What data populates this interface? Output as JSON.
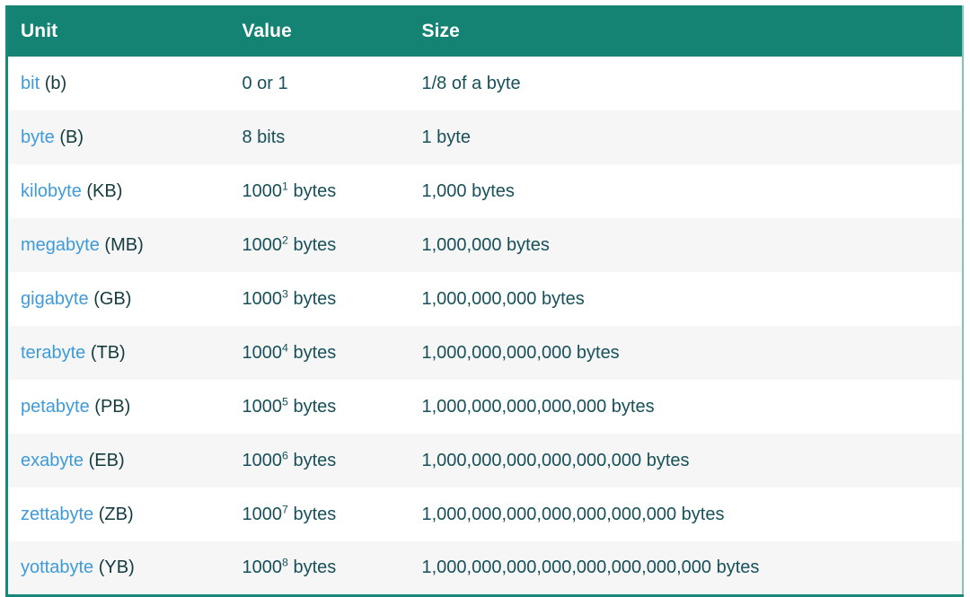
{
  "table": {
    "columns": [
      {
        "key": "unit",
        "label": "Unit"
      },
      {
        "key": "value",
        "label": "Value"
      },
      {
        "key": "size",
        "label": "Size"
      }
    ],
    "header_background": "#148373",
    "header_text_color": "#ffffff",
    "link_color": "#3f9ad8",
    "text_color": "#17505a",
    "border_color": "#17887a",
    "stripe_color": "#f5f6f5",
    "rows": [
      {
        "unit_name": "bit",
        "unit_abbr": "(b)",
        "value_base": "0 or 1",
        "value_exponent": "",
        "value_suffix": "",
        "size": "1/8 of a byte"
      },
      {
        "unit_name": "byte",
        "unit_abbr": "(B)",
        "value_base": "8 bits",
        "value_exponent": "",
        "value_suffix": "",
        "size": "1 byte"
      },
      {
        "unit_name": "kilobyte",
        "unit_abbr": "(KB)",
        "value_base": "1000",
        "value_exponent": "1",
        "value_suffix": " bytes",
        "size": "1,000 bytes"
      },
      {
        "unit_name": "megabyte",
        "unit_abbr": "(MB)",
        "value_base": "1000",
        "value_exponent": "2",
        "value_suffix": " bytes",
        "size": "1,000,000 bytes"
      },
      {
        "unit_name": "gigabyte",
        "unit_abbr": "(GB)",
        "value_base": "1000",
        "value_exponent": "3",
        "value_suffix": " bytes",
        "size": "1,000,000,000 bytes"
      },
      {
        "unit_name": "terabyte",
        "unit_abbr": "(TB)",
        "value_base": "1000",
        "value_exponent": "4",
        "value_suffix": " bytes",
        "size": "1,000,000,000,000 bytes"
      },
      {
        "unit_name": "petabyte",
        "unit_abbr": "(PB)",
        "value_base": "1000",
        "value_exponent": "5",
        "value_suffix": " bytes",
        "size": "1,000,000,000,000,000 bytes"
      },
      {
        "unit_name": "exabyte",
        "unit_abbr": "(EB)",
        "value_base": "1000",
        "value_exponent": "6",
        "value_suffix": " bytes",
        "size": "1,000,000,000,000,000,000 bytes"
      },
      {
        "unit_name": "zettabyte",
        "unit_abbr": "(ZB)",
        "value_base": "1000",
        "value_exponent": "7",
        "value_suffix": " bytes",
        "size": "1,000,000,000,000,000,000,000 bytes"
      },
      {
        "unit_name": "yottabyte",
        "unit_abbr": "(YB)",
        "value_base": "1000",
        "value_exponent": "8",
        "value_suffix": " bytes",
        "size": "1,000,000,000,000,000,000,000,000 bytes"
      }
    ]
  }
}
